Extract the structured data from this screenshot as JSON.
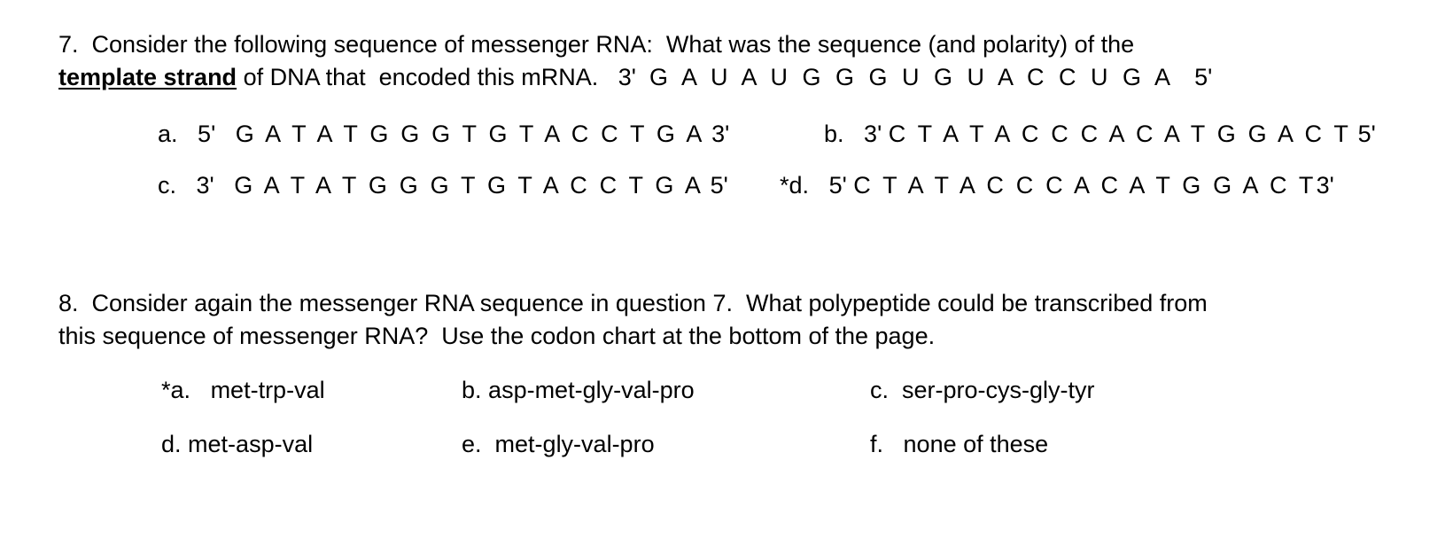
{
  "document": {
    "background_color": "#ffffff",
    "text_color": "#000000"
  },
  "question7": {
    "line1": "7.  Consider the following sequence of messenger RNA:  What was the sequence (and polarity) of the",
    "line2_emphasis": "template strand",
    "line2_part1": " of DNA that  encoded this mRNA.   3'  ",
    "line2_sequence": "G A U A U G G G U G U A C C U G A",
    "line2_end": "   5'",
    "options": [
      {
        "label": "a.",
        "prefix": "5'",
        "sequence": "G A T A T G G G T G T A C C T G A",
        "suffix": "3'",
        "correct_marker": ""
      },
      {
        "label": "b.",
        "prefix": "3'",
        "sequence": "C T A T A C C C A C A T G G A C T",
        "suffix": "5'",
        "correct_marker": ""
      },
      {
        "label": "c.",
        "prefix": "3'",
        "sequence": "G A T A T G G G T G T A C C T G A",
        "suffix": "5'",
        "correct_marker": ""
      },
      {
        "label": "d.",
        "prefix": "5'",
        "sequence": "C T A T A C C C A C A T G G A C T",
        "suffix": "3'",
        "correct_marker": "*"
      }
    ]
  },
  "question8": {
    "line1": "8.  Consider again the messenger RNA sequence in question 7.  What polypeptide could be transcribed from",
    "line2": "this sequence of messenger RNA?  Use the codon chart at the bottom of the page.",
    "options": [
      {
        "label": "a.",
        "text": "met-trp-val",
        "correct_marker": "*"
      },
      {
        "label": "b.",
        "text": "asp-met-gly-val-pro",
        "correct_marker": ""
      },
      {
        "label": "c.",
        "text": "ser-pro-cys-gly-tyr",
        "correct_marker": ""
      },
      {
        "label": "d.",
        "text": "met-asp-val",
        "correct_marker": ""
      },
      {
        "label": "e.",
        "text": "met-gly-val-pro",
        "correct_marker": ""
      },
      {
        "label": "f.",
        "text": "none of these",
        "correct_marker": ""
      }
    ]
  }
}
